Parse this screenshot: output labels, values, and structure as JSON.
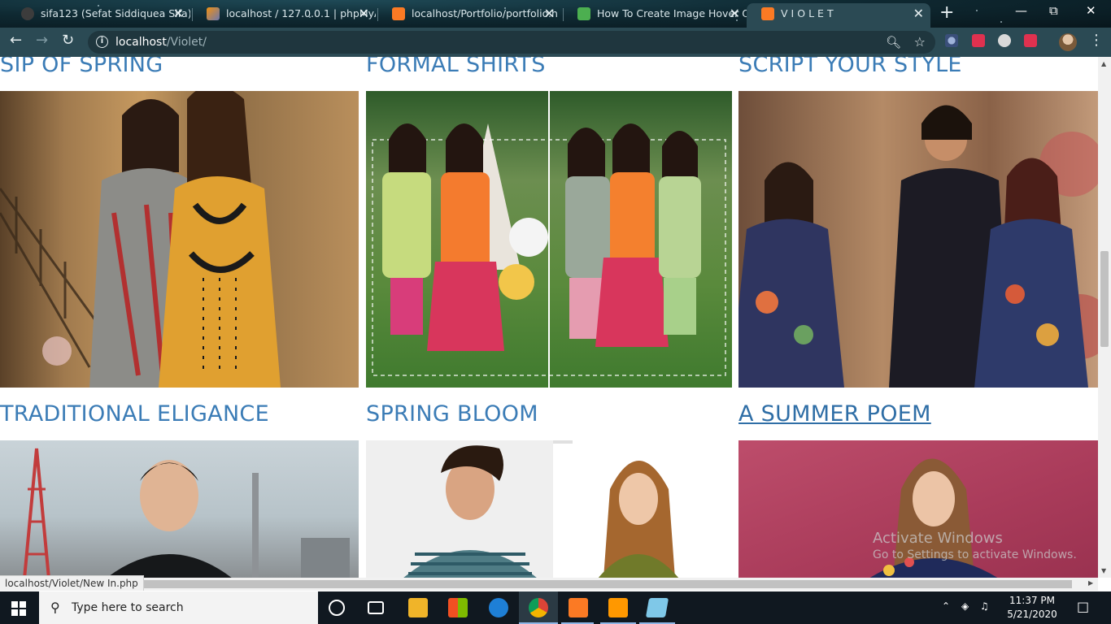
{
  "browser": {
    "tabs": [
      {
        "label": "sifa123 (Sefat Siddiquea Sifa)",
        "favicon_color": "#3c3c3c",
        "active": false
      },
      {
        "label": "localhost / 127.0.0.1 | phpMyA",
        "favicon_color": "#f29111",
        "active": false
      },
      {
        "label": "localhost/Portfolio/portfolio.h",
        "favicon_color": "#fb7a24",
        "active": false
      },
      {
        "label": "How To Create Image Hover O",
        "favicon_color": "#4caf50",
        "active": false
      },
      {
        "label": "VIOLET",
        "favicon_color": "#fb7a24",
        "active": true
      }
    ],
    "tab_close_glyph": "✕",
    "new_tab_glyph": "+",
    "url_host": "localhost",
    "url_path": "/Violet/",
    "status_url": "localhost/Violet/New In.php"
  },
  "page": {
    "cards": [
      {
        "title": "SIP OF SPRING"
      },
      {
        "title": "FORMAL SHIRTS"
      },
      {
        "title": "SCRIPT YOUR STYLE"
      },
      {
        "title": "TRADITIONAL ELIGANCE"
      },
      {
        "title": "SPRING BLOOM"
      },
      {
        "title": "A SUMMER POEM"
      }
    ]
  },
  "watermark": {
    "line1": "Activate Windows",
    "line2": "Go to Settings to activate Windows."
  },
  "taskbar": {
    "search_placeholder": "Type here to search",
    "time": "11:37 PM",
    "date": "5/21/2020"
  },
  "colors": {
    "chrome_bg": "#2b4a54",
    "title_link": "#3b7cb6",
    "taskbar_bg": "#101820"
  }
}
